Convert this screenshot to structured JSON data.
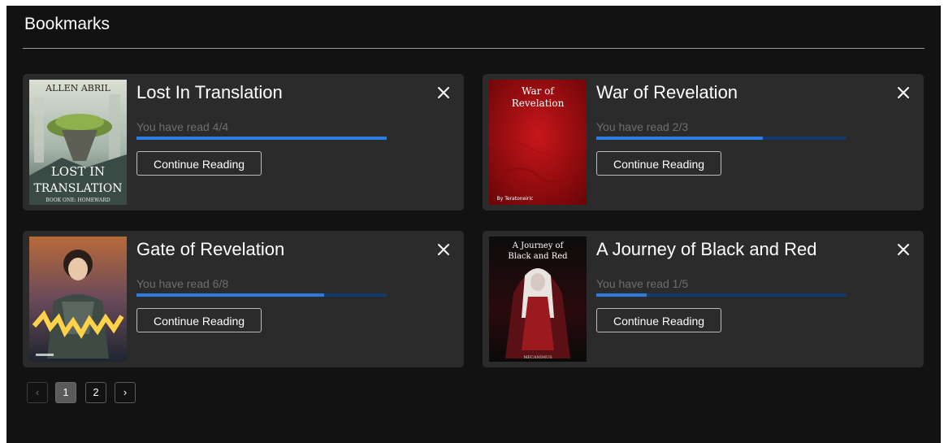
{
  "page": {
    "title": "Bookmarks"
  },
  "bookmarks": [
    {
      "title": "Lost In Translation",
      "progress_text": "You have read 4/4",
      "progress": 1.0,
      "continue_label": "Continue Reading",
      "cover": {
        "author": "ALLEN ABRIL",
        "line1": "LOST IN",
        "line2": "TRANSLATION",
        "subtitle": "BOOK ONE: HOMEWARD"
      }
    },
    {
      "title": "War of Revelation",
      "progress_text": "You have read 2/3",
      "progress": 0.667,
      "continue_label": "Continue Reading",
      "cover": {
        "line1": "War of",
        "line2": "Revelation",
        "byline": "By Teratoneiric"
      }
    },
    {
      "title": "Gate of Revelation",
      "progress_text": "You have read 6/8",
      "progress": 0.75,
      "continue_label": "Continue Reading",
      "cover": {}
    },
    {
      "title": "A Journey of Black and Red",
      "progress_text": "You have read 1/5",
      "progress": 0.2,
      "continue_label": "Continue Reading",
      "cover": {
        "line1": "A Journey of",
        "line2": "Black and Red",
        "byline": "MECANIMUS"
      }
    }
  ],
  "pagination": {
    "prev": "‹",
    "pages": [
      "1",
      "2"
    ],
    "current": "1",
    "next": "›"
  },
  "icons": {
    "close": "close-icon"
  },
  "colors": {
    "accent": "#2a7ce0",
    "track": "#123a6c",
    "card": "#2b2b2b",
    "background": "#121212"
  }
}
